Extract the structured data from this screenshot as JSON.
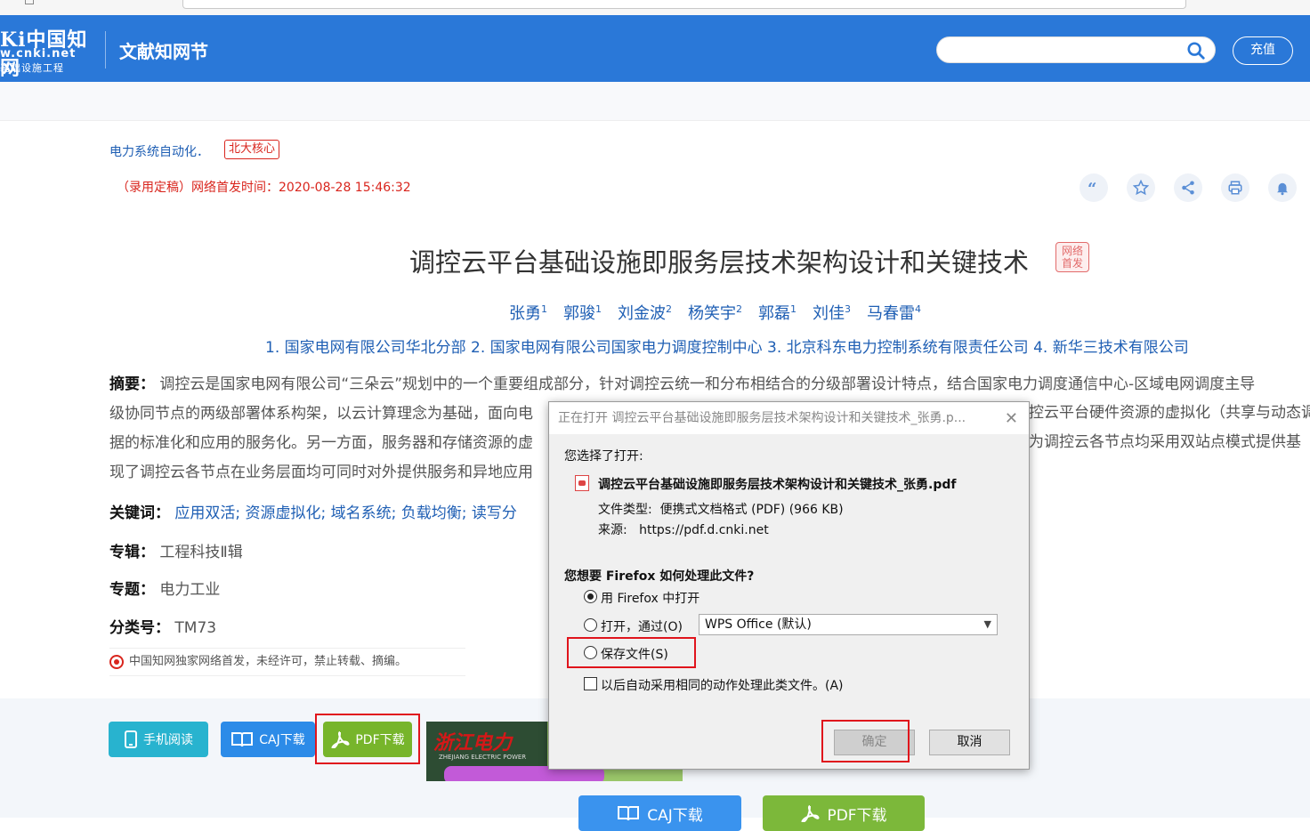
{
  "header": {
    "logo_line1": "Ki中国知网",
    "logo_line2": "w.cnki.net",
    "logo_line3": "基础设施工程",
    "site_name": "文献知网节",
    "search_placeholder": "",
    "recharge_label": "充值"
  },
  "article": {
    "journal": "电力系统自动化．",
    "core_badge": "北大核心",
    "pub_time": "（录用定稿）网络首发时间：2020-08-28 15:46:32",
    "title": "调控云平台基础设施即服务层技术架构设计和关键技术",
    "net_badge_l1": "网络",
    "net_badge_l2": "首发",
    "authors": [
      {
        "name": "张勇",
        "sup": "1"
      },
      {
        "name": "郭骏",
        "sup": "1"
      },
      {
        "name": "刘金波",
        "sup": "2"
      },
      {
        "name": "杨笑宇",
        "sup": "2"
      },
      {
        "name": "郭磊",
        "sup": "1"
      },
      {
        "name": "刘佳",
        "sup": "3"
      },
      {
        "name": "马春雷",
        "sup": "4"
      }
    ],
    "affiliations": "1. 国家电网有限公司华北分部  2. 国家电网有限公司国家电力调度控制中心  3. 北京科东电力控制系统有限责任公司  4. 新华三技术有限公司",
    "abstract_label": "摘要：",
    "abstract_lines": [
      "调控云是国家电网有限公司“三朵云”规划中的一个重要组成部分，针对调控云统一和分布相结合的分级部署设计特点，结合国家电力调度通信中心-区域电网调度主导",
      "级协同节点的两级部署体系构架，以云计算理念为基础，面向电",
      "据的标准化和应用的服务化。另一方面，服务器和存储资源的虚",
      "现了调控云各节点在业务层面均可同时对外提供服务和异地应用"
    ],
    "abstract_right": [
      "控云平台硬件资源的虚拟化（共享与动态调",
      "为调控云各节点均采用双站点模式提供基"
    ],
    "keywords_label": "关键词：",
    "keywords": "应用双活;  资源虚拟化;  域名系统;  负载均衡;  读写分",
    "album_label": "专辑：",
    "album": "工程科技Ⅱ辑",
    "topic_label": "专题：",
    "topic": "电力工业",
    "class_label": "分类号：",
    "class_no": "TM73",
    "notice": "中国知网独家网络首发，未经许可，禁止转载、摘编。"
  },
  "actions": {
    "mobile_read": "手机阅读",
    "caj_download": "CAJ下载",
    "pdf_download": "PDF下载",
    "ad_title": "浙江电力",
    "ad_sub": "ZHEJIANG ELECTRIC POWER",
    "big_caj": "CAJ下载",
    "big_pdf": "PDF下载"
  },
  "dialog": {
    "title": "正在打开 调控云平台基础设施即服务层技术架构设计和关键技术_张勇.p...",
    "chose_open": "您选择了打开:",
    "filename": "调控云平台基础设施即服务层技术架构设计和关键技术_张勇.pdf",
    "filetype_label": "文件类型:",
    "filetype": "便携式文档格式 (PDF) (966 KB)",
    "source_label": "来源:",
    "source": "https://pdf.d.cnki.net",
    "question": "您想要 Firefox 如何处理此文件?",
    "opt_open_firefox": "用 Firefox 中打开",
    "opt_open_with": "打开，通过(O)",
    "open_with_app": "WPS Office (默认)",
    "opt_save": "保存文件(S)",
    "auto_check": "以后自动采用相同的动作处理此类文件。(A)",
    "ok": "确定",
    "cancel": "取消"
  },
  "colors": {
    "header_blue": "#2a78d8",
    "link_blue": "#1f5fb4",
    "alert_red": "#d9251d",
    "highlight_red": "#e0141c"
  }
}
